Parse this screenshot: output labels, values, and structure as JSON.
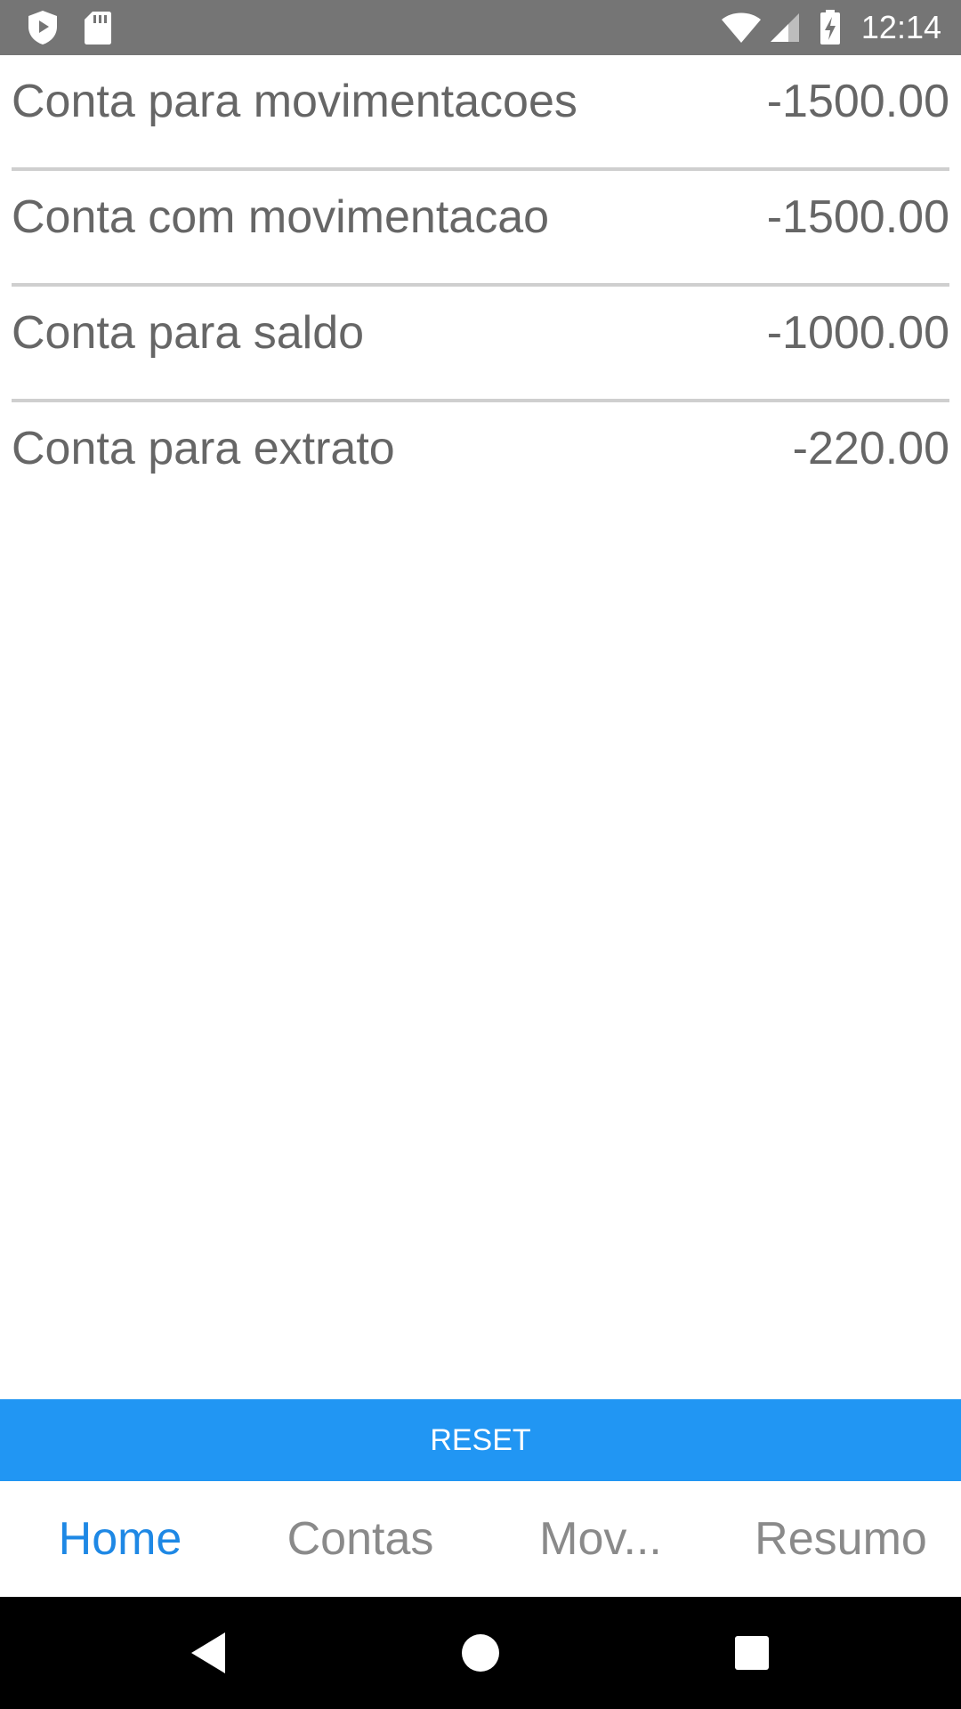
{
  "status_bar": {
    "time": "12:14",
    "left_icons": [
      "shield-play-icon",
      "sd-card-icon"
    ],
    "right_icons": [
      "wifi-icon",
      "signal-icon",
      "battery-charging-icon"
    ],
    "background": "#757575"
  },
  "accounts": [
    {
      "name": "Conta para movimentacoes",
      "value": "-1500.00"
    },
    {
      "name": "Conta com movimentacao",
      "value": "-1500.00"
    },
    {
      "name": "Conta para saldo",
      "value": "-1000.00"
    },
    {
      "name": "Conta para extrato",
      "value": "-220.00"
    }
  ],
  "reset_button": {
    "label": "RESET",
    "color": "#2196F3"
  },
  "tabs": [
    {
      "label": "Home",
      "active": true
    },
    {
      "label": "Contas",
      "active": false
    },
    {
      "label": "Mov...",
      "active": false
    },
    {
      "label": "Resumo",
      "active": false
    }
  ],
  "colors": {
    "active_tab": "#1E88E5",
    "inactive_tab": "#8A8A8A",
    "text": "#666666",
    "divider": "#CFCFCF"
  },
  "nav_bar": {
    "icons": [
      "back-icon",
      "home-icon",
      "recents-icon"
    ]
  }
}
